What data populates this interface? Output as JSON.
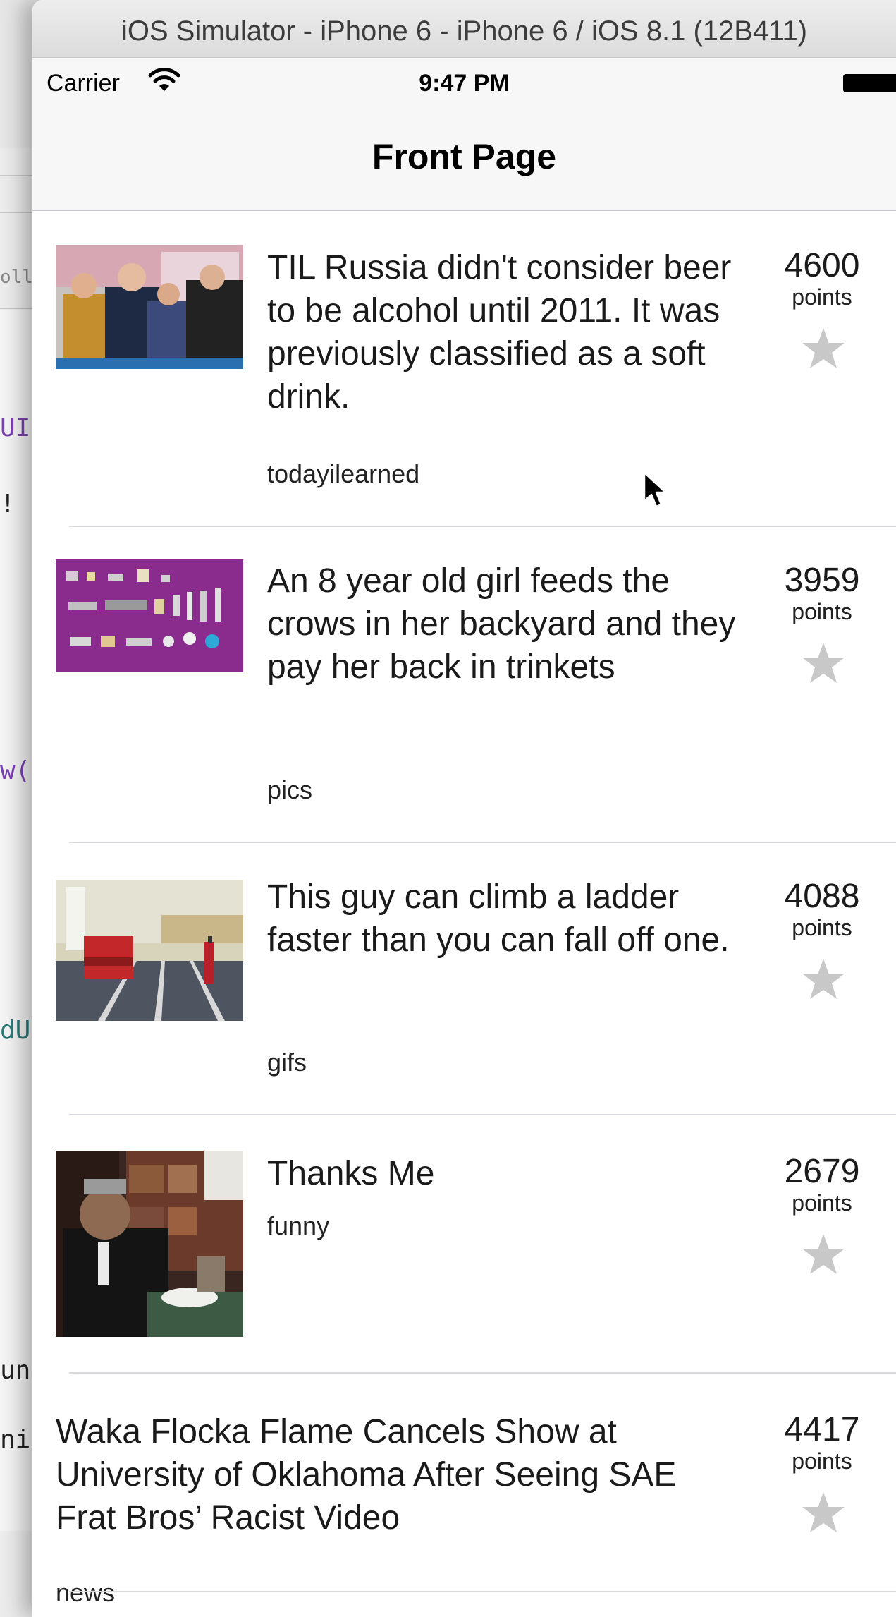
{
  "editor": {
    "fragments": [
      "olle",
      "UI",
      "!",
      "w(",
      "dU",
      "un",
      "ni"
    ],
    "fragment_colors": [
      "#8a8a8a",
      "#7b3fb5",
      "#222222",
      "#7b3fb5",
      "#2a7a7a",
      "#222222",
      "#222222"
    ]
  },
  "simulator": {
    "window_title": "iOS Simulator - iPhone 6 - iPhone 6 / iOS 8.1 (12B411)"
  },
  "status_bar": {
    "carrier": "Carrier",
    "time": "9:47 PM",
    "wifi_icon": "wifi-icon",
    "battery_icon": "battery-icon"
  },
  "nav": {
    "title": "Front Page"
  },
  "posts": [
    {
      "title": "TIL Russia didn't consider beer to be alcohol until 2011. It was previously classified as a soft drink.",
      "subreddit": "todayilearned",
      "score": "4600",
      "points_label": "points",
      "has_thumbnail": true,
      "thumbnail_icon": "photo-thumbnail"
    },
    {
      "title": "An 8 year old girl feeds the crows in her backyard and they pay her back in trinkets",
      "subreddit": "pics",
      "score": "3959",
      "points_label": "points",
      "has_thumbnail": true,
      "thumbnail_icon": "photo-thumbnail"
    },
    {
      "title": "This guy can climb a ladder faster than you can fall off one.",
      "subreddit": "gifs",
      "score": "4088",
      "points_label": "points",
      "has_thumbnail": true,
      "thumbnail_icon": "photo-thumbnail"
    },
    {
      "title": "Thanks Me",
      "subreddit": "funny",
      "score": "2679",
      "points_label": "points",
      "has_thumbnail": true,
      "thumbnail_icon": "photo-thumbnail"
    },
    {
      "title": "Waka Flocka Flame Cancels Show at University of Oklahoma After Seeing SAE Frat Bros’ Racist Video",
      "subreddit": "news",
      "score": "4417",
      "points_label": "points",
      "has_thumbnail": false
    }
  ],
  "icons": {
    "favorite": "star-icon",
    "pointer": "cursor-icon"
  },
  "colors": {
    "star": "#c8c8c8",
    "separator": "#d9d9dd",
    "bar_background": "#f7f7f7"
  }
}
